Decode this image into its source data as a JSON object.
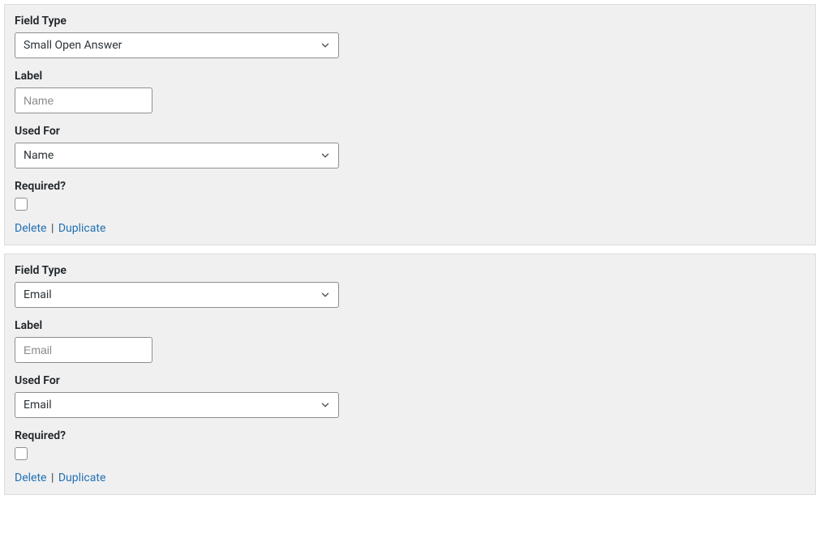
{
  "labels": {
    "field_type": "Field Type",
    "label": "Label",
    "used_for": "Used For",
    "required": "Required?"
  },
  "actions": {
    "delete": "Delete",
    "duplicate": "Duplicate",
    "sep": "|"
  },
  "panels": [
    {
      "field_type_value": "Small Open Answer",
      "label_placeholder": "Name",
      "label_value": "",
      "used_for_value": "Name",
      "required_checked": false
    },
    {
      "field_type_value": "Email",
      "label_placeholder": "Email",
      "label_value": "",
      "used_for_value": "Email",
      "required_checked": false
    }
  ]
}
